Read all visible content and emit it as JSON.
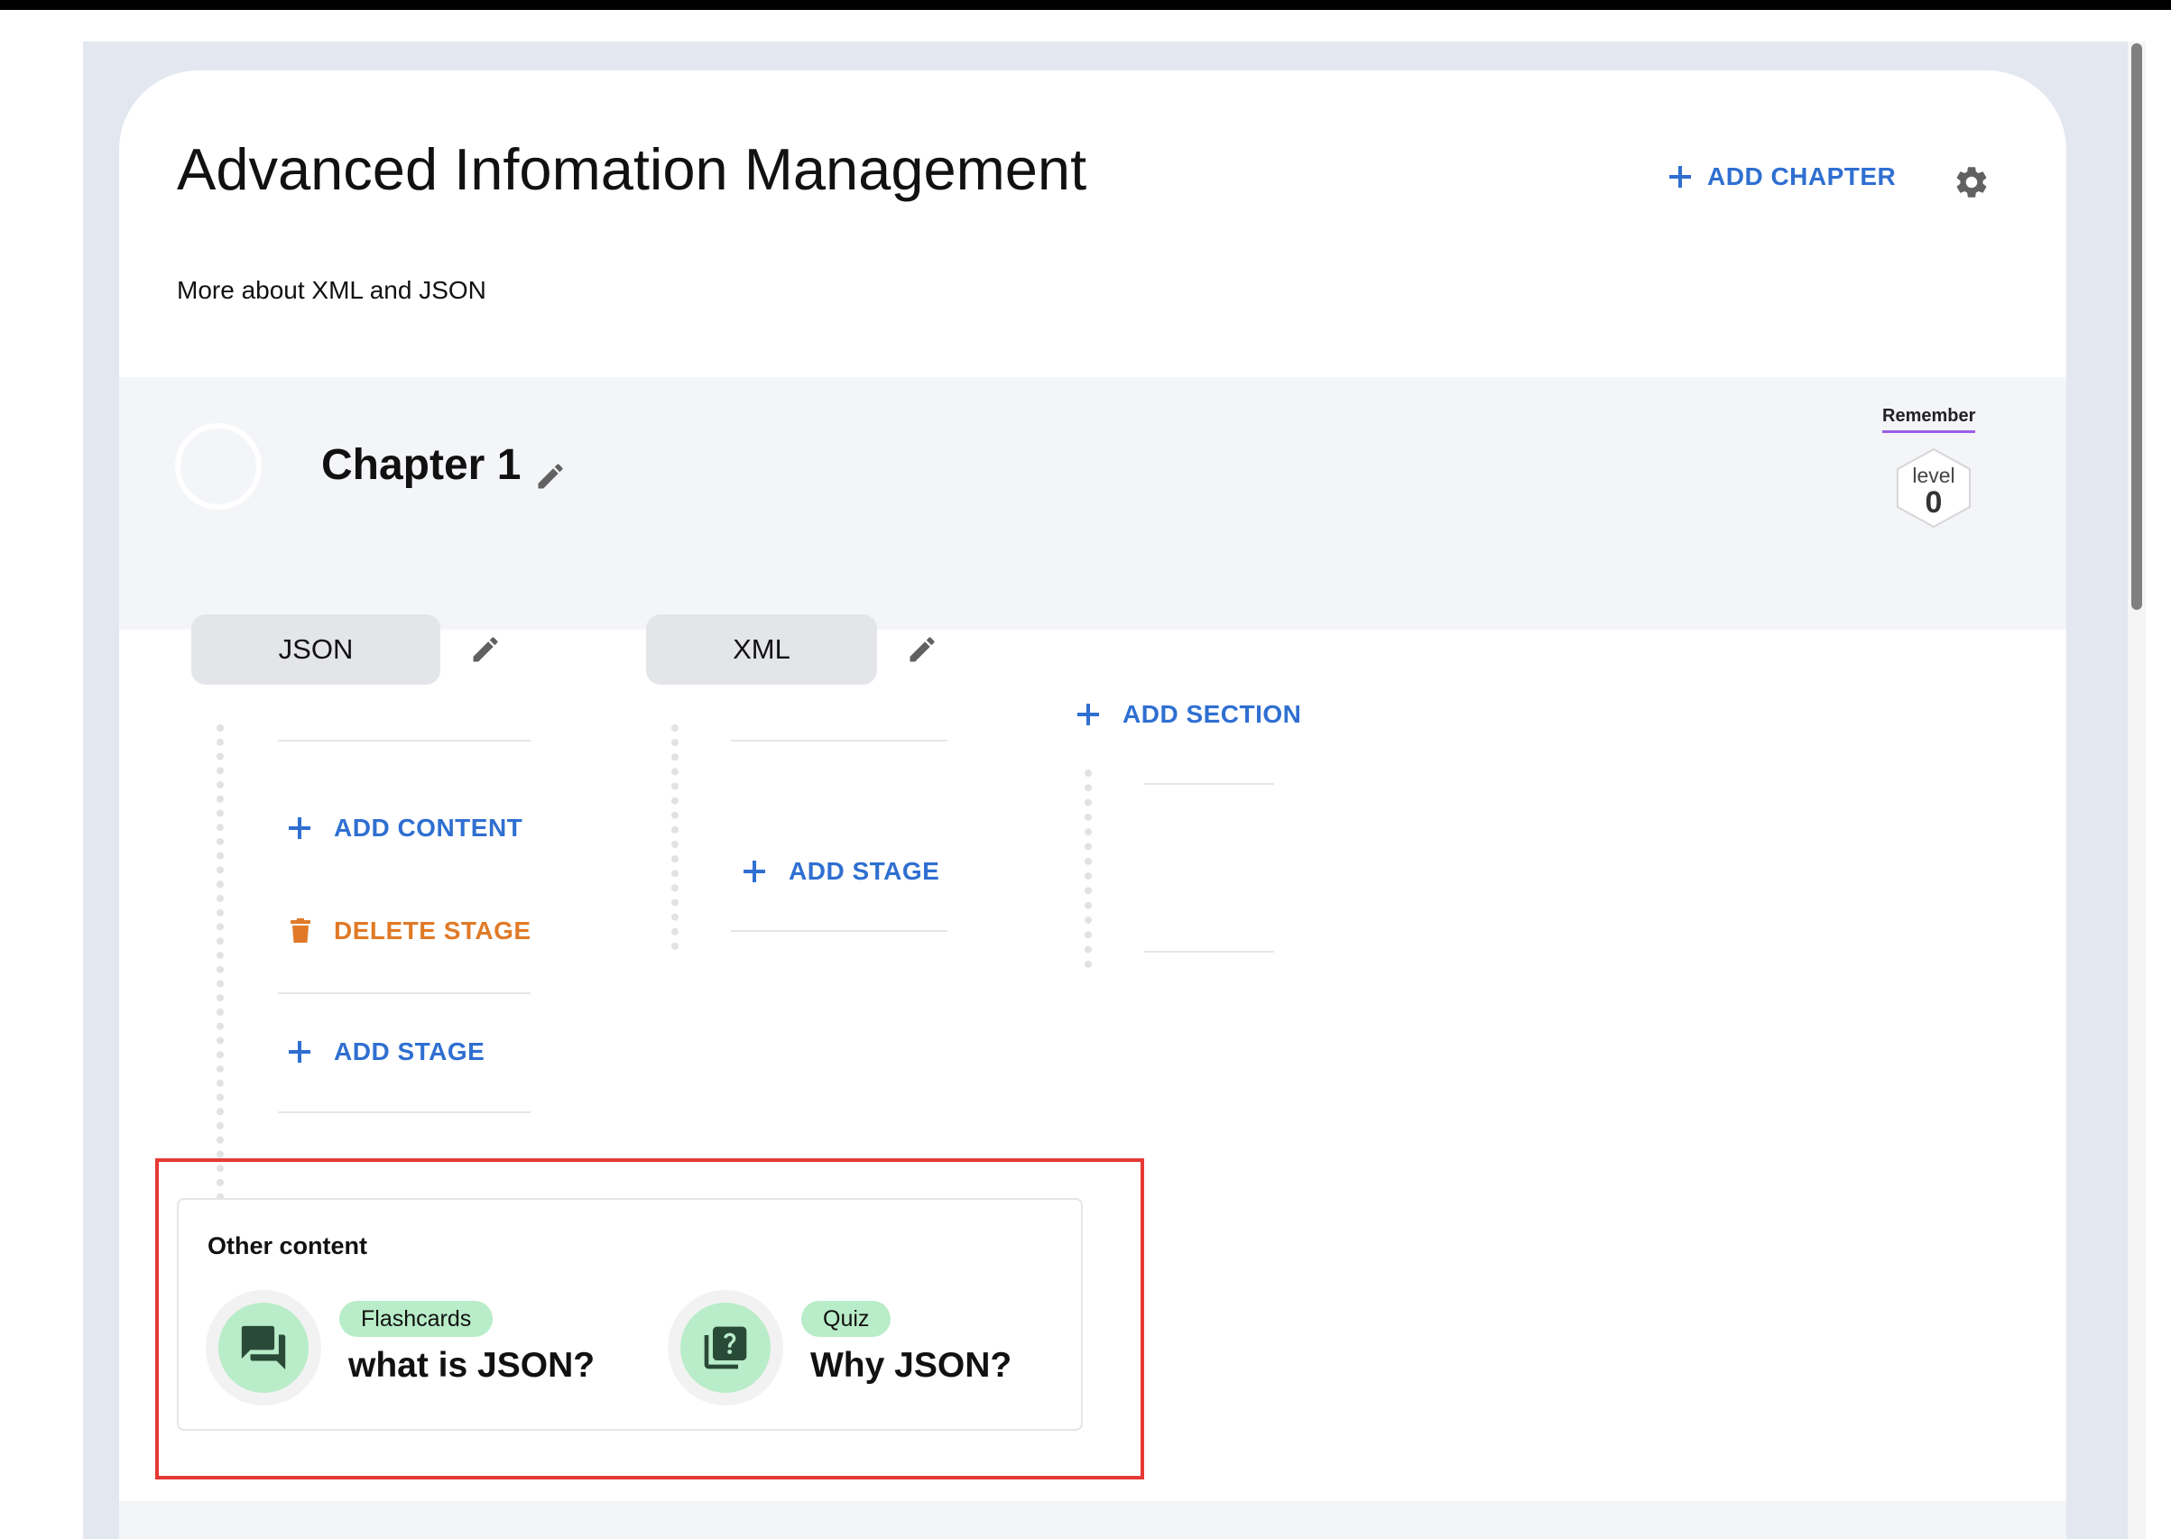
{
  "course": {
    "title": "Advanced Infomation Management",
    "description": "More about XML and JSON",
    "add_chapter_label": "ADD CHAPTER"
  },
  "chapter": {
    "title": "Chapter 1",
    "badge_label": "Remember",
    "level_label": "level",
    "level_value": "0"
  },
  "sections": [
    {
      "label": "JSON",
      "actions": {
        "add_content": "ADD CONTENT",
        "delete_stage": "DELETE STAGE",
        "add_stage": "ADD STAGE"
      }
    },
    {
      "label": "XML",
      "actions": {
        "add_stage": "ADD STAGE"
      }
    }
  ],
  "add_section_label": "ADD SECTION",
  "other_content": {
    "title": "Other content",
    "items": [
      {
        "type": "Flashcards",
        "name": "what is JSON?",
        "icon": "chat-bubbles-icon"
      },
      {
        "type": "Quiz",
        "name": "Why JSON?",
        "icon": "quiz-icon"
      }
    ]
  },
  "colors": {
    "accent_blue": "#2f6fd1",
    "danger_orange": "#e07a28",
    "badge_green": "#b9ecc8",
    "highlight_red": "#e53935",
    "remember_underline": "#9b5de5"
  }
}
